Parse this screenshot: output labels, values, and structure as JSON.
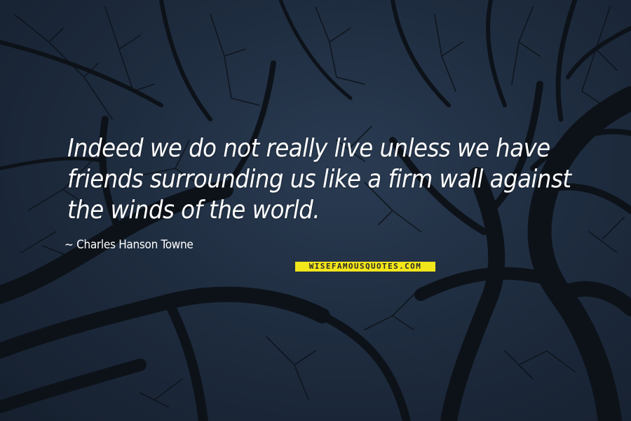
{
  "quote": {
    "text": "Indeed we do not really live unless we have friends surrounding us like a firm wall against the winds of the world.",
    "author": "~ Charles Hanson Towne"
  },
  "watermark": {
    "text": "WISEFAMOUSQUOTES.COM",
    "background_color": "#f2e51a"
  },
  "background": {
    "sky_color": "#1f2d40",
    "branch_color": "#0d1219"
  }
}
